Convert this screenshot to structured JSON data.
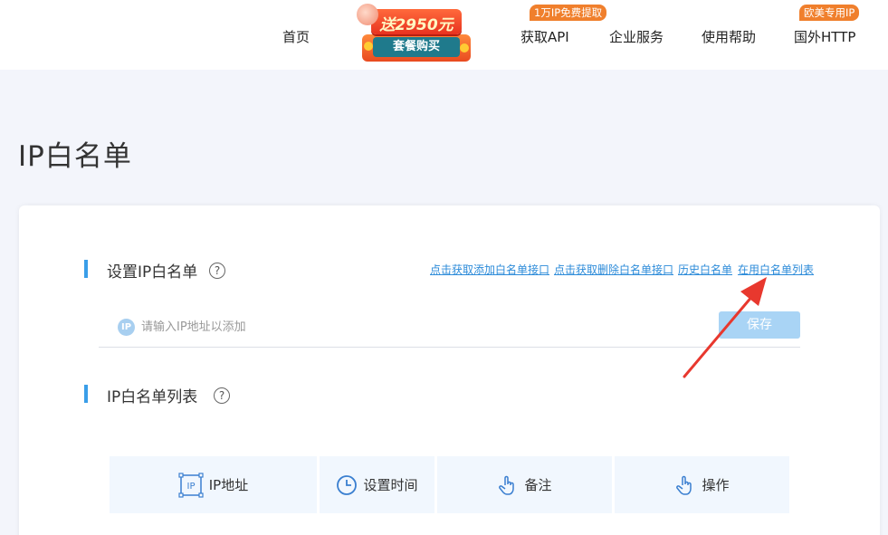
{
  "header": {
    "nav": [
      {
        "label": "首页"
      },
      {
        "label": "获取API",
        "badge": "1万IP免费提取"
      },
      {
        "label": "企业服务"
      },
      {
        "label": "使用帮助"
      },
      {
        "label": "国外HTTP",
        "badge": "欧美专用IP"
      }
    ],
    "promo": {
      "top_text": "送2950元",
      "button": "套餐购买"
    }
  },
  "page_title": "IP白名单",
  "set_section": {
    "title": "设置IP白名单",
    "help": "?",
    "links": [
      "点击获取添加白名单接口",
      "点击获取删除白名单接口",
      "历史白名单",
      "在用白名单列表"
    ],
    "input_icon": "IP",
    "input_placeholder": "请输入IP地址以添加",
    "input_value": "",
    "save_label": "保存"
  },
  "list_section": {
    "title": "IP白名单列表",
    "help": "?",
    "columns": [
      {
        "label": "IP地址",
        "icon": "ip-address-icon"
      },
      {
        "label": "设置时间",
        "icon": "clock-icon"
      },
      {
        "label": "备注",
        "icon": "hand-pointer-icon"
      },
      {
        "label": "操作",
        "icon": "hand-pointer-icon"
      }
    ]
  },
  "colors": {
    "accent": "#3a9ee8",
    "link": "#2c8bd9",
    "save_button": "#a9d4f5",
    "badge": "#f07f2c",
    "arrow": "#e8382e"
  }
}
